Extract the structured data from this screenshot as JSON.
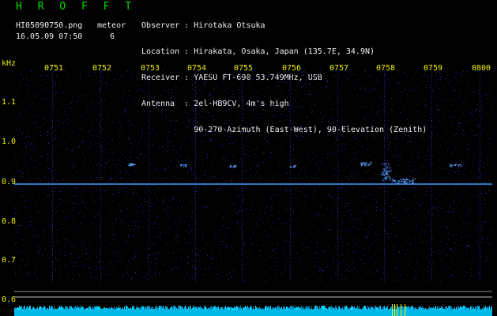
{
  "header": {
    "title": "H R O F F T",
    "filename": "HI05090750.png",
    "meteor_label": "meteor",
    "datetime": "16.05.09 07:50",
    "meteor_count": "6"
  },
  "info": {
    "observer": "Observer : Hirotaka Otsuka",
    "location": "Location : Hirakata, Osaka, Japan (135.7E, 34.9N)",
    "receiver": "Receiver : YAESU FT-690 53.749MHz, USB",
    "antenna": "Antenna  : 2el-HB9CV, 4m's high",
    "direction": "           90-270-Azimuth (East-West), 90-Elevation (Zenith)"
  },
  "axis": {
    "y_unit": "kHz",
    "y_ticks": [
      "1.1",
      "1.0",
      "0.9",
      "0.8",
      "0.7",
      "0.6"
    ],
    "x_ticks": [
      "0751",
      "0752",
      "0753",
      "0754",
      "0755",
      "0756",
      "0757",
      "0758",
      "0759",
      "0800"
    ]
  },
  "colors": {
    "text_green": "#00e000",
    "text_white": "#f0f0f0",
    "text_yellow": "#f0f000",
    "carrier_line": "#3aa0ff",
    "noise_band": "#00b8e8",
    "background": "#000000"
  }
}
